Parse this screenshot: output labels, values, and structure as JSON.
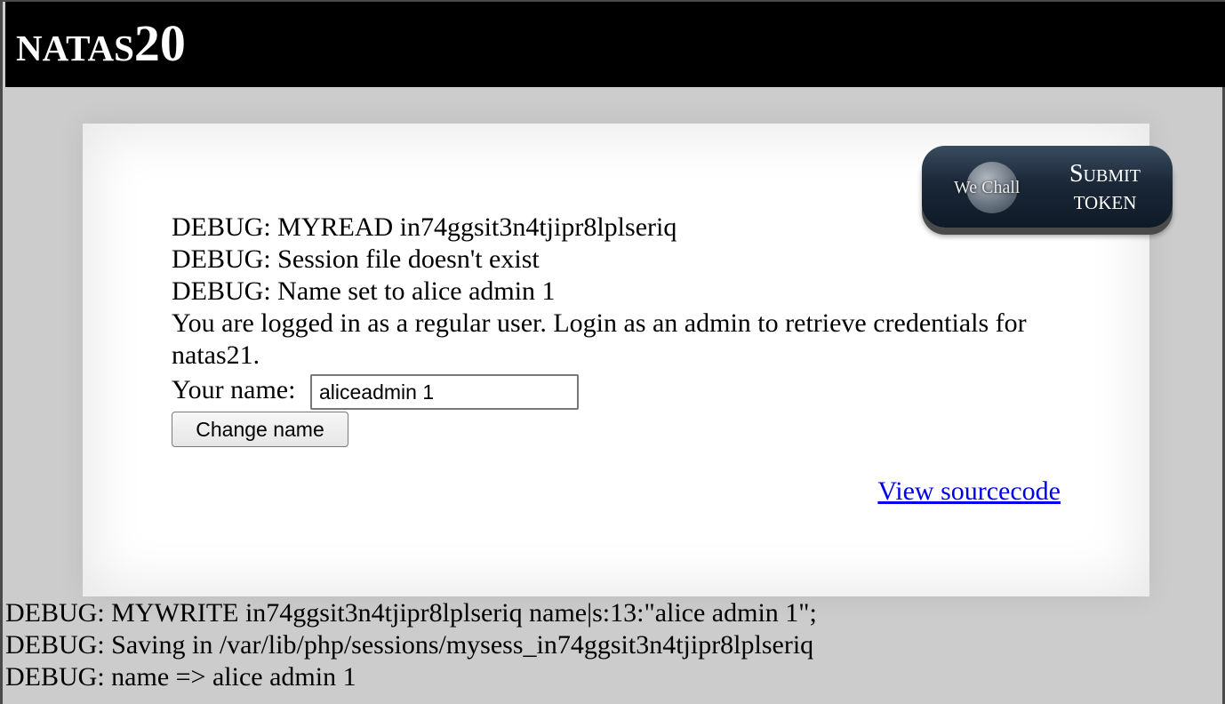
{
  "header": {
    "title_prefix": "natas",
    "title_number": "20"
  },
  "content": {
    "debug_lines": [
      "DEBUG: MYREAD in74ggsit3n4tjipr8lplseriq",
      "DEBUG: Session file doesn't exist",
      "DEBUG: Name set to alice admin 1"
    ],
    "status_message": "You are logged in as a regular user. Login as an admin to retrieve credentials for natas21.",
    "form": {
      "name_label": "Your name:",
      "name_value": "aliceadmin 1",
      "submit_label": "Change name"
    },
    "source_link": "View sourcecode"
  },
  "wechall": {
    "brand": "We Chall",
    "submit": "Submit",
    "token": "TOKEN"
  },
  "bottom_debug": [
    "DEBUG: MYWRITE in74ggsit3n4tjipr8lplseriq name|s:13:\"alice admin 1\";",
    "DEBUG: Saving in /var/lib/php/sessions/mysess_in74ggsit3n4tjipr8lplseriq",
    "DEBUG: name => alice admin 1"
  ]
}
